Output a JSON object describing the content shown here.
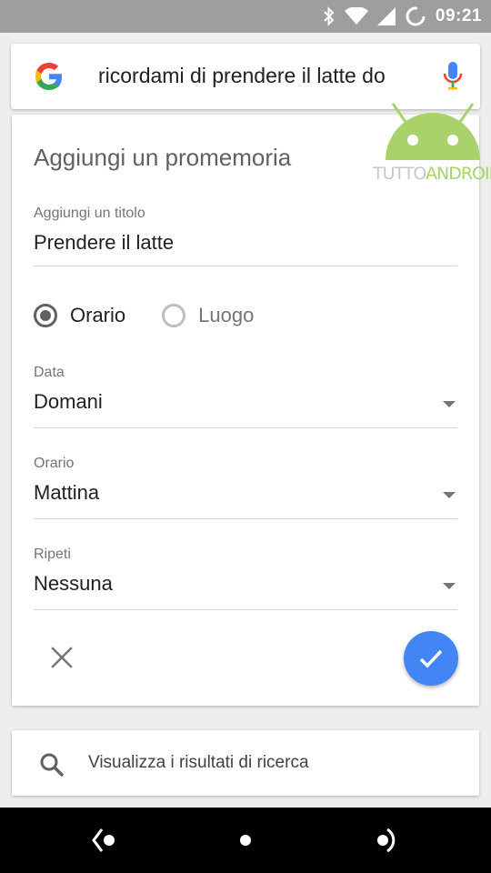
{
  "status_bar": {
    "time": "09:21",
    "icons": [
      "bluetooth-icon",
      "wifi-icon",
      "signal-icon",
      "sync-icon"
    ]
  },
  "search": {
    "query": "ricordami di prendere il latte do",
    "logo": "google-g-icon",
    "mic": "microphone-icon"
  },
  "watermark": {
    "text_gray": "TUTTO",
    "text_green": "ANDROID",
    "accent_color": "#a9d26b"
  },
  "reminder": {
    "title": "Aggiungi un promemoria",
    "title_field": {
      "label": "Aggiungi un titolo",
      "value": "Prendere il latte"
    },
    "type_options": [
      {
        "label": "Orario",
        "checked": true
      },
      {
        "label": "Luogo",
        "checked": false
      }
    ],
    "date_field": {
      "label": "Data",
      "value": "Domani"
    },
    "time_field": {
      "label": "Orario",
      "value": "Mattina"
    },
    "repeat_field": {
      "label": "Ripeti",
      "value": "Nessuna"
    },
    "confirm_color": "#4285f4"
  },
  "results": {
    "label": "Visualizza i risultati di ricerca"
  },
  "nav": [
    "back-icon",
    "home-icon",
    "assist-icon"
  ]
}
